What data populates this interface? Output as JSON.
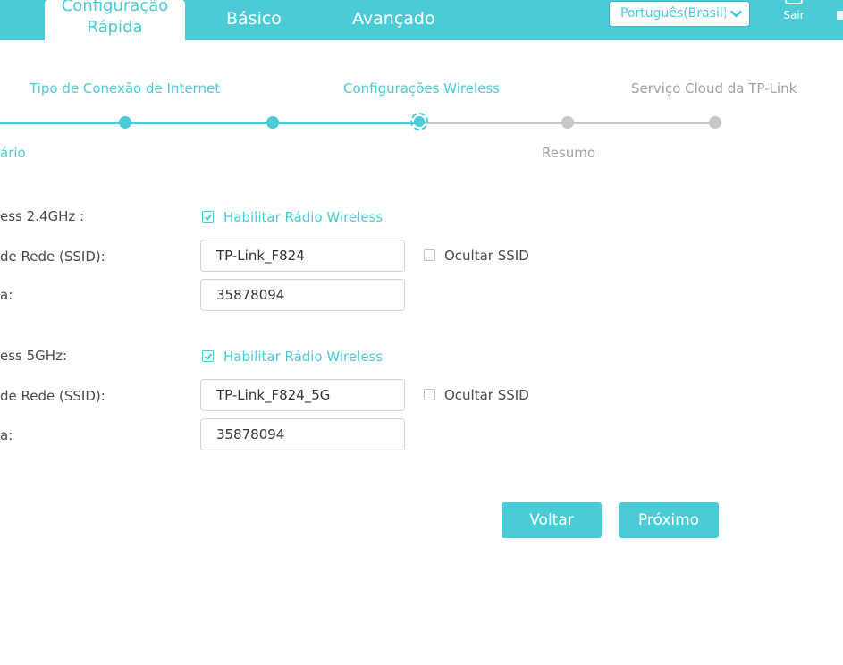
{
  "nav": {
    "quick_setup_line1": "Configuração",
    "quick_setup_line2": "Rápida",
    "basic": "Básico",
    "advanced": "Avançado",
    "language": "Português(Brasil)",
    "logout": "Sair"
  },
  "steps": {
    "top": [
      "Tipo de Conexão de Internet",
      "Configurações Wireless",
      "Serviço Cloud da TP-Link"
    ],
    "bottom": [
      "ário",
      "Resumo"
    ]
  },
  "band_24": {
    "label": "ess 2.4GHz :",
    "enable_label": "Habilitar Rádio Wireless",
    "enabled": true,
    "ssid_label": "de Rede (SSID):",
    "ssid": "TP-Link_F824",
    "hide_ssid_label": "Ocultar SSID",
    "hide_ssid": false,
    "password_label": "a:",
    "password": "35878094"
  },
  "band_5": {
    "label": "ess 5GHz:",
    "enable_label": "Habilitar Rádio Wireless",
    "enabled": true,
    "ssid_label": "de Rede (SSID):",
    "ssid": "TP-Link_F824_5G",
    "hide_ssid_label": "Ocultar SSID",
    "hide_ssid": false,
    "password_label": "a:",
    "password": "35878094"
  },
  "buttons": {
    "back": "Voltar",
    "next": "Próximo"
  },
  "colors": {
    "accent": "#4acbd6",
    "inactive": "#c8c8c8",
    "text": "#4a4a4a"
  }
}
